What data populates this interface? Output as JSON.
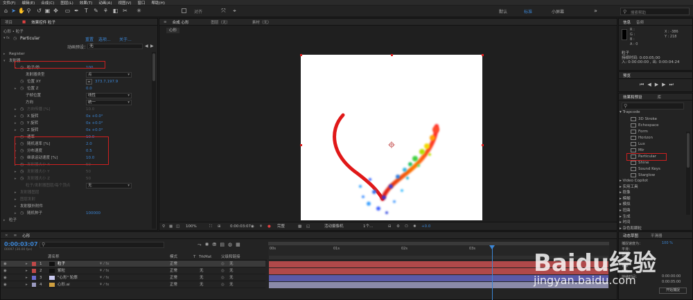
{
  "menu": [
    "文件(F)",
    "编辑(E)",
    "合成(C)",
    "图层(L)",
    "效果(T)",
    "动画(A)",
    "视图(V)",
    "窗口",
    "帮助(H)"
  ],
  "toolbar": {
    "snap_label": "对齐",
    "workspaces": [
      "默认",
      "标准",
      "小屏幕"
    ],
    "search_placeholder": "搜索帮助"
  },
  "project": {
    "tab": "项目",
    "effects_tab": "效果控件 粒子",
    "breadcrumb": "心形 • 粒子"
  },
  "effect": {
    "name": "Particular",
    "links": [
      "重置",
      "选项...",
      "关于..."
    ],
    "preset_label": "动画预设：",
    "preset_value": "无",
    "rows": [
      {
        "label": "Register",
        "indent": 1,
        "tri": true
      },
      {
        "label": "发射器",
        "indent": 1,
        "tri": true,
        "open": true
      },
      {
        "label": "粒子/秒",
        "indent": 3,
        "tri": true,
        "sw": true,
        "value": "100"
      },
      {
        "label": "发射器类型",
        "indent": 4,
        "select": "点"
      },
      {
        "label": "位置 XY",
        "indent": 3,
        "sw": true,
        "value": "373.7,197.9",
        "crosshair": true
      },
      {
        "label": "位置 Z",
        "indent": 3,
        "tri": true,
        "sw": true,
        "value": "0.0"
      },
      {
        "label": "子帧位置",
        "indent": 4,
        "select": "线性"
      },
      {
        "label": "方向",
        "indent": 4,
        "select": "统一"
      },
      {
        "label": "方向传播 [%]",
        "indent": 3,
        "tri": true,
        "sw": true,
        "value": "10.0",
        "dim": true
      },
      {
        "label": "X 旋转",
        "indent": 3,
        "tri": true,
        "sw": true,
        "value": "0x +0.0°"
      },
      {
        "label": "Y 旋转",
        "indent": 3,
        "tri": true,
        "sw": true,
        "value": "0x +0.0°"
      },
      {
        "label": "Z 旋转",
        "indent": 3,
        "tri": true,
        "sw": true,
        "value": "0x +0.0°"
      },
      {
        "label": "速率",
        "indent": 3,
        "tri": true,
        "sw": true,
        "value": "10.0"
      },
      {
        "label": "随机速率 [%]",
        "indent": 3,
        "tri": true,
        "sw": true,
        "value": "2.0"
      },
      {
        "label": "分布速度",
        "indent": 3,
        "tri": true,
        "sw": true,
        "value": "0.5"
      },
      {
        "label": "继承运动速度 [%]",
        "indent": 3,
        "tri": true,
        "sw": true,
        "value": "10.0"
      },
      {
        "label": "发射器大小 X",
        "indent": 3,
        "tri": true,
        "sw": true,
        "value": "50",
        "dim": true
      },
      {
        "label": "发射器大小 Y",
        "indent": 3,
        "tri": true,
        "sw": true,
        "value": "50",
        "dim": true
      },
      {
        "label": "发射器大小 Z",
        "indent": 3,
        "tri": true,
        "sw": true,
        "value": "50",
        "dim": true
      },
      {
        "label": "粒子/发射器图层/每个顶点",
        "indent": 4,
        "select": "无",
        "dim": true
      },
      {
        "label": "发射器图层",
        "indent": 3,
        "tri": true,
        "dim": true
      },
      {
        "label": "图层发射",
        "indent": 3,
        "tri": true,
        "dim": true
      },
      {
        "label": "发射额外附件",
        "indent": 3,
        "tri": true
      },
      {
        "label": "随机种子",
        "indent": 3,
        "tri": true,
        "sw": true,
        "value": "100000"
      },
      {
        "label": "粒子",
        "indent": 1,
        "tri": true
      }
    ]
  },
  "composition": {
    "tabs": [
      "合成 心形",
      "图层（无）",
      "素材（无）"
    ],
    "breadcrumb": "心形",
    "zoom": "100%",
    "timecode": "0:00:03:07",
    "resolution": "完整",
    "camera": "活动摄像机",
    "views": "1个...",
    "exposure": "+0.0"
  },
  "info": {
    "tabs": [
      "信息",
      "音频"
    ],
    "lines": [
      "R :",
      "G :",
      "B :",
      "A : 0"
    ],
    "coords": [
      "X : -386",
      "Y : 218"
    ],
    "layer": "粒子",
    "duration": "持续时间: 0:00:05:00",
    "in_out": "入: 0:00:00:00 , 出: 0:00:04:24"
  },
  "preview": {
    "tab": "预览"
  },
  "effects_presets": {
    "tab": "效果和预设",
    "tab2": "库",
    "root": "▾ Trapcode",
    "items": [
      "3D Stroke",
      "Echospace",
      "Form",
      "Horizon",
      "Lux",
      "Mir",
      "Particular",
      "Shine",
      "Sound Keys",
      "Starglow"
    ],
    "categories": [
      "▸ Video Copilot",
      "▸ 实用工具",
      "▸ 抠像",
      "▸ 模糊",
      "▸ 模拟",
      "▸ 扭曲",
      "▸ 生成",
      "▸ 时间",
      "▸ 杂色和颗粒"
    ]
  },
  "timeline": {
    "tab": "心形",
    "timecode": "0:00:03:07",
    "frame_info": "00097 (30.00 fps)",
    "headers": [
      "源名称",
      "模式",
      "T",
      "TrkMat",
      "父级和链接"
    ],
    "ruler": [
      "00s",
      "01s",
      "02s",
      "03s"
    ],
    "layers": [
      {
        "num": "1",
        "name": "粒子",
        "color": "#c04848",
        "mode": "正常",
        "trk": "",
        "parent": "无",
        "bar": "#b0494a"
      },
      {
        "num": "2",
        "name": "紫粒",
        "color": "#c04848",
        "mode": "正常",
        "trk": "无",
        "parent": "无",
        "bar": "#b0494a"
      },
      {
        "num": "3",
        "name": "\"心形\" 轮廓",
        "color": "#6b6bd0",
        "mode": "正常",
        "trk": "无",
        "parent": "无",
        "bar": "#5a5aa8"
      },
      {
        "num": "4",
        "name": "心形.ai",
        "color": "#9a9ac0",
        "mode": "正常",
        "trk": "无",
        "parent": "无",
        "bar": "#8a8aa8"
      }
    ]
  },
  "sketch": {
    "tabs": [
      "动态草图",
      "平滑器"
    ],
    "capture_speed": "100 %",
    "rows": [
      "捕捉速度为：",
      "平滑：",
      "显示：",
      "线框",
      "背景",
      "开始：",
      "持续时间："
    ],
    "start": "0:00:00:00",
    "duration": "0:00:05:00",
    "button": "开始捕捉"
  },
  "watermark": {
    "brand": "Baidu经验",
    "url": "jingyan.baidu.com"
  }
}
